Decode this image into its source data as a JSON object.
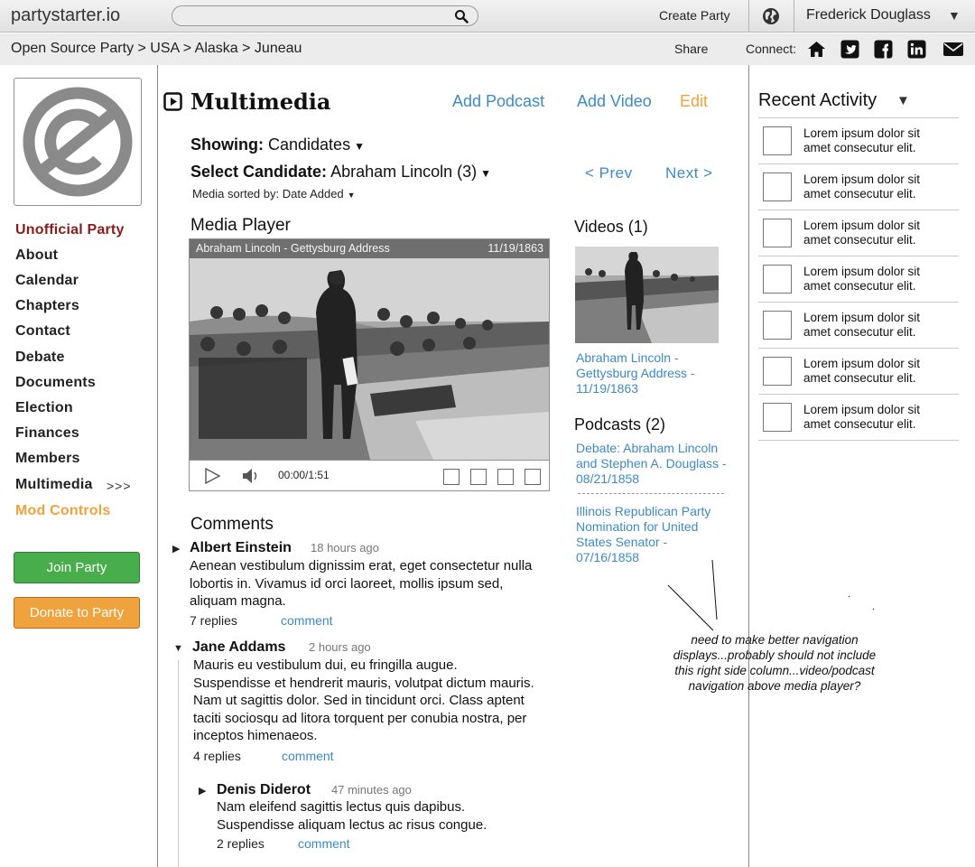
{
  "topbar": {
    "logo": "partystarter.io",
    "create_label": "Create Party",
    "user_name": "Frederick Douglass",
    "user_menu_icon": "▼"
  },
  "breadcrumb": "Open Source Party > USA > Alaska > Juneau",
  "share_label": "Share",
  "connect_label": "Connect:",
  "social_icons": [
    "home-icon",
    "twitter-icon",
    "facebook-icon",
    "linkedin-icon",
    "mail-icon"
  ],
  "sidebar": {
    "party_name": "Unofficial Party",
    "items": [
      "About",
      "Calendar",
      "Chapters",
      "Contact",
      "Debate",
      "Documents",
      "Election",
      "Finances",
      "Members",
      "Multimedia"
    ],
    "active_marker": ">>>",
    "mod_controls": "Mod Controls",
    "join_label": "Join Party",
    "donate_label": "Donate to Party"
  },
  "main": {
    "title": "Multimedia",
    "add_podcast": "Add Podcast",
    "add_video": "Add Video",
    "edit": "Edit",
    "showing_label": "Showing:",
    "showing_value": "Candidates",
    "select_label": "Select Candidate:",
    "select_value": "Abraham Lincoln (3)",
    "sorted_label": "Media sorted by: Date Added",
    "prev": "< Prev",
    "next": "Next >"
  },
  "player": {
    "heading": "Media Player",
    "clip_title": "Abraham Lincoln - Gettysburg Address",
    "clip_date": "11/19/1863",
    "time": "00:00/1:51"
  },
  "videos": {
    "heading": "Videos (1)",
    "items": [
      "Abraham Lincoln - Gettysburg Address - 11/19/1863"
    ]
  },
  "podcasts": {
    "heading": "Podcasts (2)",
    "items": [
      "Debate: Abraham Lincoln and Stephen A. Douglass - 08/21/1858",
      "Illinois Republican Party Nomination for United States Senator - 07/16/1858"
    ]
  },
  "comments": {
    "heading": "Comments",
    "comment_link": "comment",
    "items": [
      {
        "author": "Albert Einstein",
        "time": "18 hours ago",
        "body": "Aenean vestibulum dignissim erat, eget consectetur nulla lobortis in. Vivamus id orci laoreet, mollis ipsum sed, aliquam magna.",
        "replies": "7 replies"
      },
      {
        "author": "Jane Addams",
        "time": "2 hours ago",
        "body": "Mauris eu vestibulum dui, eu fringilla augue. Suspendisse et hendrerit mauris, volutpat dictum mauris. Nam ut sagittis dolor. Sed in tincidunt orci. Class aptent taciti sociosqu ad litora torquent per conubia nostra, per inceptos himenaeos.",
        "replies": "4 replies"
      },
      {
        "author": "Denis Diderot",
        "time": "47 minutes ago",
        "body": "Nam eleifend sagittis lectus quis dapibus. Suspendisse aliquam lectus ac risus congue.",
        "replies": "2 replies"
      }
    ]
  },
  "annotation": "need to make better navigation displays...probably should not include this right side column...video/podcast navigation above media player?",
  "recent_activity": {
    "title": "Recent Activity",
    "menu_icon": "▼",
    "items": [
      "Lorem ipsum dolor sit amet consecutur elit.",
      "Lorem ipsum dolor sit amet consecutur elit.",
      "Lorem ipsum dolor sit amet consecutur elit.",
      "Lorem ipsum dolor sit amet consecutur elit.",
      "Lorem ipsum dolor sit amet consecutur elit.",
      "Lorem ipsum dolor sit amet consecutur elit.",
      "Lorem ipsum dolor sit amet consecutur elit."
    ]
  }
}
